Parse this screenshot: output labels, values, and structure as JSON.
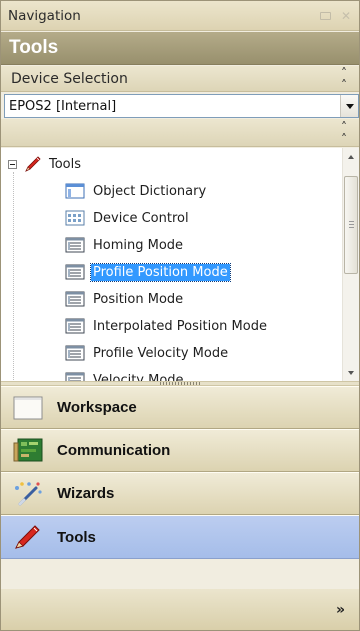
{
  "navigation": {
    "title": "Navigation"
  },
  "section": {
    "title": "Tools"
  },
  "device_selection": {
    "label": "Device Selection",
    "selected": "EPOS2 [Internal]"
  },
  "tree": {
    "root": "Tools",
    "items": [
      {
        "label": "Object Dictionary",
        "icon": "object-dictionary-icon"
      },
      {
        "label": "Device Control",
        "icon": "device-control-icon"
      },
      {
        "label": "Homing Mode",
        "icon": "mode-window-icon"
      },
      {
        "label": "Profile Position Mode",
        "icon": "mode-window-icon",
        "selected": true
      },
      {
        "label": "Position Mode",
        "icon": "mode-window-icon"
      },
      {
        "label": "Interpolated Position Mode",
        "icon": "mode-window-icon"
      },
      {
        "label": "Profile Velocity Mode",
        "icon": "mode-window-icon"
      },
      {
        "label": "Velocity Mode",
        "icon": "mode-window-icon"
      }
    ]
  },
  "nav_buttons": [
    {
      "label": "Workspace",
      "icon": "workspace-icon"
    },
    {
      "label": "Communication",
      "icon": "communication-icon"
    },
    {
      "label": "Wizards",
      "icon": "wizards-icon"
    },
    {
      "label": "Tools",
      "icon": "tools-icon",
      "active": true
    }
  ],
  "colors": {
    "selection": "#3399ff",
    "section_header": "#a59c7a",
    "active_button": "#b3c7ee"
  }
}
